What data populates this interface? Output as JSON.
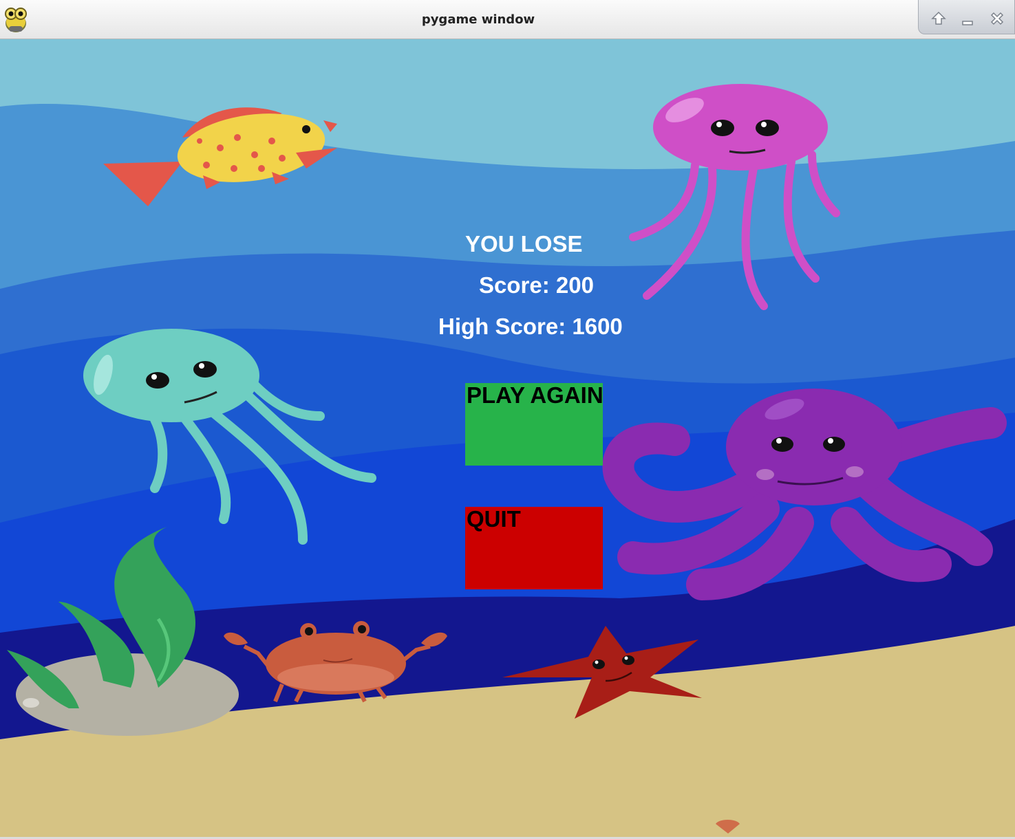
{
  "window": {
    "title": "pygame window"
  },
  "titlebar_controls": [
    "maximize-icon",
    "minimize-icon",
    "close-icon"
  ],
  "game_over": {
    "result": "YOU LOSE",
    "score": "Score: 200",
    "high_score": "High Score: 1600"
  },
  "buttons": {
    "play_again": {
      "label": "PLAY AGAIN",
      "color": "#27b34a"
    },
    "quit": {
      "label": "QUIT",
      "color": "#cc0000"
    }
  },
  "colors": {
    "sky": "#7fc4d8",
    "wave_light": "#4a95d4",
    "wave_mid": "#2f6fd0",
    "water_deep": "#1247d6",
    "water_dark": "#13178f",
    "sand": "#d6c384"
  }
}
